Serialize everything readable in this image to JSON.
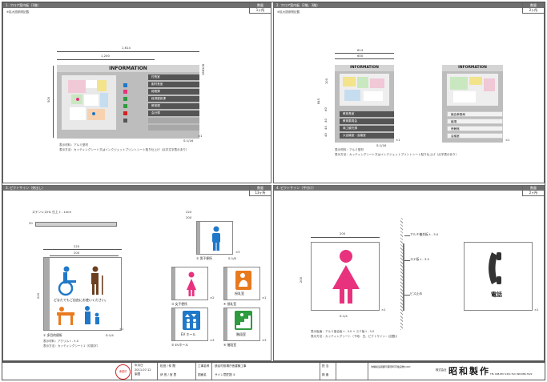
{
  "colors": {
    "header_bar": "#6f6f6f",
    "pink": "#e8327e",
    "blue": "#1f78c8",
    "green": "#2e9b3e",
    "orange": "#e87a1e",
    "brown": "#6b3f1f",
    "dark_row": "#555555",
    "stamp_red": "#d32020"
  },
  "q1": {
    "title": "1. フロア案内板（1階）",
    "qty_label": "数量",
    "qty_value": "1ヶ所",
    "scale_note": "※拡大図参照記載",
    "dim_total": "1,614",
    "dim_inner": "1,200",
    "dim_height": "500",
    "dim_side_a": "108",
    "dim_side_b": "188",
    "sign_title": "INFORMATION",
    "depts": [
      "村長室",
      "副村長室",
      "総務課",
      "経済建設課",
      "教育課",
      "会計課"
    ],
    "icon_x1": "×1",
    "scale": "S:1/16",
    "spec1": "表示材料：アルミ型材",
    "spec2": "表示方法：カッティングシート又はインクジェットプリントシート貼り仕上げ（点字文字表示あり）"
  },
  "q2": {
    "title": "2. フロア案内板（2階、3階）",
    "qty_label": "数量",
    "qty_value": "2ヶ所",
    "scale_note": "※拡大図参照記載",
    "dim_total": "614",
    "dim_inner": "600",
    "dim_height": "845",
    "dims_left": [
      "100",
      "60",
      "40",
      "40",
      "40"
    ],
    "sign_title": "INFORMATION",
    "left_rows": [
      "教育長室",
      "教育委員会",
      "商工観光課",
      "大会議室・会議室"
    ],
    "right_rows": [
      "議会事務局",
      "議場",
      "傍聴席",
      "会議室"
    ],
    "x1": "×1",
    "scale": "S:1/16",
    "spec1": "表示材料：アルミ型材",
    "spec2": "表示方法：カッティングシート又はインクジェットプリントシート貼り仕上げ（点字表示あり）"
  },
  "q3": {
    "title": "3. ピクトサイン（突出し）",
    "qty_label": "数量",
    "qty_value": "13ヶ所",
    "rail_label": "ステンレスHL 仕上 t - 1mm",
    "rail_dim": "20",
    "dim_220": "220",
    "dim_200": "200",
    "dim_side": "220",
    "main_caption": "どなたでもご自由にお使いください。",
    "main_label": "① 多目的便所",
    "main_x": "×1",
    "main_scale": "S:1/4",
    "spec1": "表示材料：アクリル t - 5.0",
    "spec2": "表示方法：カッティングシート1（切抜字）",
    "small_dim_a": "220",
    "small_dim_b": "200",
    "mens_label": "② 男子便所",
    "mens_scale": "S:1/8",
    "mens_x": "×3",
    "signs": [
      {
        "label": "③ 女子便所",
        "x": "×2"
      },
      {
        "label": "④ 授乳室",
        "x": "×1",
        "text": "授乳室"
      },
      {
        "label": "⑤ EVホール",
        "x": "×3",
        "text": "EV ホール"
      },
      {
        "label": "⑥ 階段室",
        "x": "×3",
        "text": "階段室"
      }
    ]
  },
  "q4": {
    "title": "4. ピクトサイン（平付け）",
    "qty_label": "数量",
    "qty_value": "2ヶ所",
    "dim_200": "200",
    "dim_side": "200",
    "scale": "S:1/4",
    "x1": "×1",
    "call1": "アルミ複合板 t - 3.0",
    "call2": "ステ板 t - 3.0",
    "call3": "ビス止め",
    "phone_text": "電話",
    "spec1": "表示板面：アルミ複合板 t - 3.0 + ステ板 t - 3.0",
    "spec2": "表示方法：カッティングシート（下地：白、ピクトサイン：(記載)）"
  },
  "title_block": {
    "stamp": "承認印",
    "date_label1": "年月日",
    "date1": "2011.07.12",
    "by_label": "製図",
    "checker": "照合",
    "name1": "松田 / 仲 間",
    "name2": "伊 田 / 宮 里",
    "project_label": "工事名称",
    "project": "読谷村役場庁舎建築工事",
    "drawing_label": "図面名",
    "drawing": "サイン意匠図 ①",
    "check_label1": "担 当",
    "check_label2": "検 査",
    "company_addr": "沖縄県島尻郡与那原町字板良敷1467",
    "company": "昭和製作",
    "company_prefix": "株式会社",
    "tel": "TEL 098-887-2301  FAX 098-888-7922"
  }
}
